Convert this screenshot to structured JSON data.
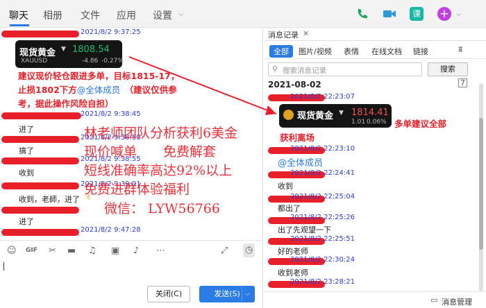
{
  "tabs": [
    "聊天",
    "相册",
    "文件",
    "应用",
    "设置"
  ],
  "chat": {
    "timestamps": [
      "2021/8/2 9:37:25",
      "2021/8/2 9:38:45",
      "2021/8/2 9:38:50",
      "2021/8/2 9:38:55",
      "2021/8/2 9:39:01",
      "2021/8/2 9:47:28"
    ],
    "quote": {
      "name": "现货黄金",
      "price": "1808.54",
      "symbol": "XAUUSD",
      "change": "-4.86",
      "change_pct": "-0.27%"
    },
    "advice_line1": "建议现价轻仓跟进多单，目标1815-17，",
    "advice_line2a": "止损1802下方",
    "advice_mention": "@全体成员",
    "advice_line2b": "（建议仅供参",
    "advice_line3": "考，据此操作风险自担）",
    "messages": [
      "进了",
      "搞了",
      "收到",
      "收到，老師，进了",
      "进了"
    ]
  },
  "ad": {
    "line1": "林老师团队分析获利6美金",
    "line2": "现价喊单　　免费解套",
    "line3": "短线准确率高达92%以上",
    "line4": "免费进群体验福利",
    "line5": "微信：  LYW56766"
  },
  "buttons": {
    "close": "关闭(C)",
    "send": "发送(S)"
  },
  "panel": {
    "title": "消息记录",
    "tabs": [
      "全部",
      "图片/视频",
      "表情",
      "在线文档",
      "链接"
    ],
    "search_placeholder": "搜索消息记录",
    "search_btn": "搜索",
    "date": "2021-08-02",
    "timestamps": [
      "2021/8/2 22:23:07",
      "2021/8/2 22:23:10",
      "2021/8/2 22:24:41",
      "2021/8/2 22:25:04",
      "2021/8/2 22:25:26",
      "2021/8/2 22:25:51",
      "2021/8/2 22:30:24",
      "2021/8/2 23:28:21"
    ],
    "quote": {
      "name": "现货黄金",
      "price": "1814.41",
      "change": "1.01",
      "change_pct": "0.06%"
    },
    "profit": "获利离场",
    "annotation": "多单建议全部",
    "messages": [
      "@全体成员",
      "收到",
      "都出了",
      "出了先观望一下",
      "好的老师",
      "收到老师"
    ],
    "footer": "消息管理"
  }
}
